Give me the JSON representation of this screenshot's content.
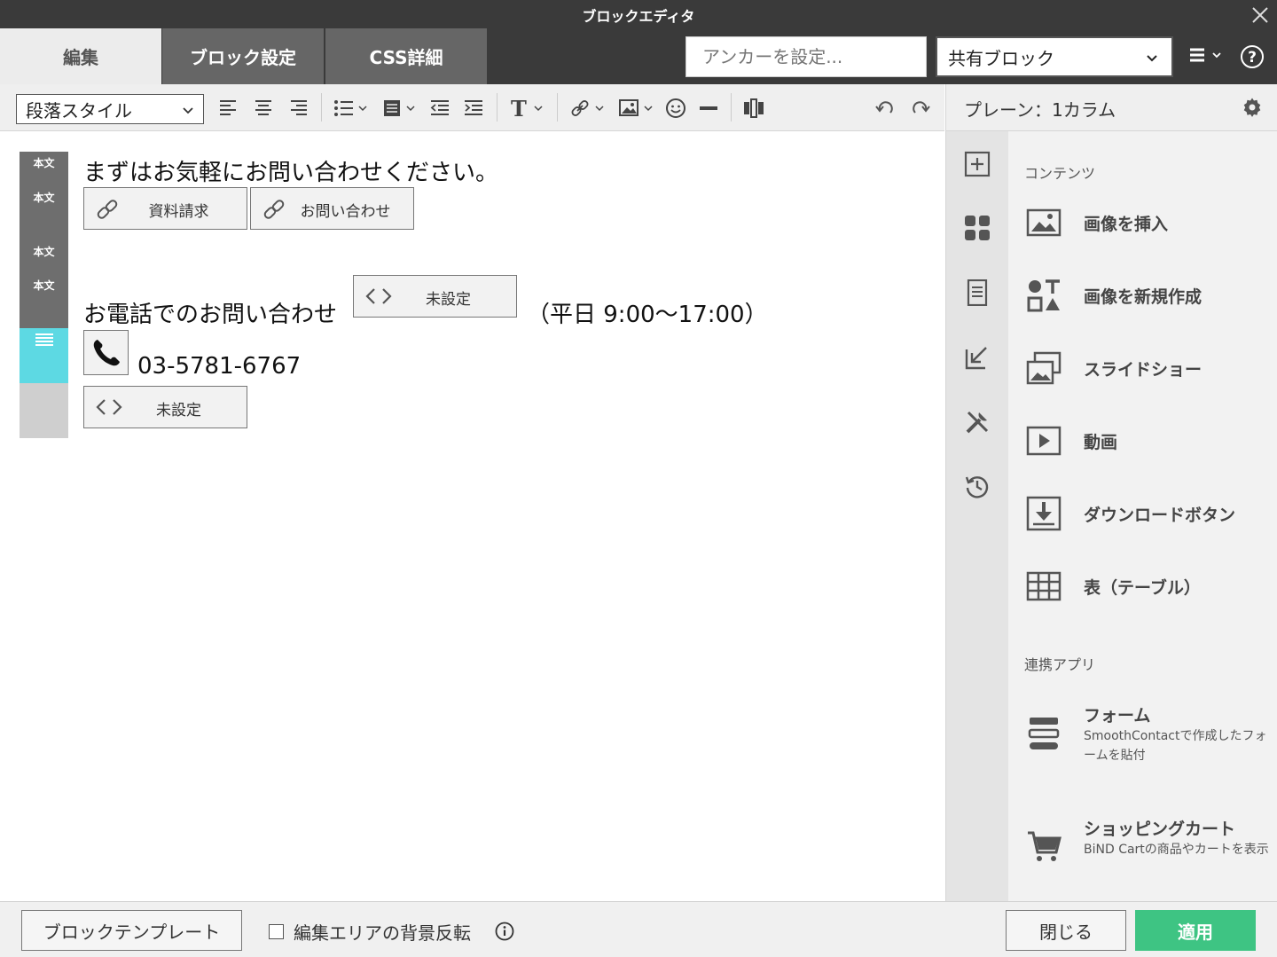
{
  "window": {
    "title": "ブロックエディタ"
  },
  "tabs": [
    {
      "label": "編集",
      "active": true
    },
    {
      "label": "ブロック設定",
      "active": false
    },
    {
      "label": "CSS詳細",
      "active": false
    }
  ],
  "anchor": {
    "placeholder": "アンカーを設定..."
  },
  "shared_block": {
    "value": "共有ブロック"
  },
  "toolbar": {
    "paragraph_style": "段落スタイル"
  },
  "panel": {
    "title": "プレーン：1カラム"
  },
  "block_strip": {
    "labels": [
      "本文",
      "本文",
      "本文",
      "本文"
    ]
  },
  "canvas": {
    "intro_text": "まずはお気軽にお問い合わせください。",
    "btn_request": "資料請求",
    "btn_contact": "お問い合わせ",
    "phone_heading": "お電話でのお問い合わせ",
    "btn_unset_1": "未設定",
    "hours": "（平日 9:00〜17:00）",
    "phone_number": "03-5781-6767",
    "btn_unset_2": "未設定"
  },
  "side": {
    "contents_label": "コンテンツ",
    "items": [
      {
        "label": "画像を挿入",
        "icon": "image-icon"
      },
      {
        "label": "画像を新規作成",
        "icon": "shapes-icon"
      },
      {
        "label": "スライドショー",
        "icon": "slideshow-icon"
      },
      {
        "label": "動画",
        "icon": "video-icon"
      },
      {
        "label": "ダウンロードボタン",
        "icon": "download-icon"
      },
      {
        "label": "表（テーブル）",
        "icon": "table-icon"
      }
    ],
    "apps_label": "連携アプリ",
    "apps": [
      {
        "label": "フォーム",
        "desc": "SmoothContactで作成したフォームを貼付",
        "icon": "form-icon"
      },
      {
        "label": "ショッピングカート",
        "desc": "BiND Cartの商品やカートを表示",
        "icon": "cart-icon"
      }
    ]
  },
  "footer": {
    "template_btn": "ブロックテンプレート",
    "bg_invert_label": "編集エリアの背景反転",
    "close_btn": "閉じる",
    "apply_btn": "適用"
  },
  "colors": {
    "titlebar": "#3a3a3a",
    "apply": "#3ec483",
    "active_block": "#5dd9e3"
  }
}
